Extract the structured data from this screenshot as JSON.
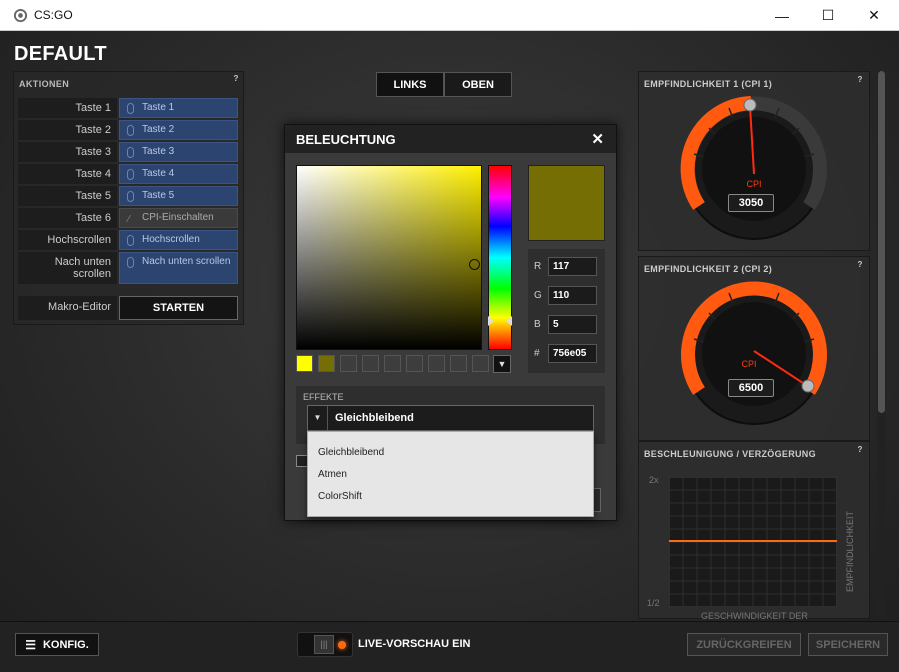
{
  "window": {
    "title": "CS:GO",
    "minimize": "—",
    "maximize": "☐",
    "close": "✕"
  },
  "profile_title": "DEFAULT",
  "actions": {
    "heading": "AKTIONEN",
    "help": "?",
    "rows": [
      {
        "label": "Taste 1",
        "value": "Taste 1"
      },
      {
        "label": "Taste 2",
        "value": "Taste 2"
      },
      {
        "label": "Taste 3",
        "value": "Taste 3"
      },
      {
        "label": "Taste 4",
        "value": "Taste 4"
      },
      {
        "label": "Taste 5",
        "value": "Taste 5"
      },
      {
        "label": "Taste 6",
        "value": "CPI-Einschalten"
      },
      {
        "label": "Hochscrollen",
        "value": "Hochscrollen"
      },
      {
        "label": "Nach unten scrollen",
        "value": "Nach unten scrollen"
      }
    ],
    "macro_label": "Makro-Editor",
    "macro_button": "STARTEN"
  },
  "toggle": {
    "left": "LINKS",
    "right": "OBEN"
  },
  "lighting": {
    "title": "BELEUCHTUNG",
    "close": "✕",
    "color": {
      "hex_color": "#756e05",
      "r": "117",
      "g": "110",
      "b": "5",
      "hex": "756e05"
    },
    "swatch_colors": [
      "#ffff00",
      "#756e05"
    ],
    "effects_label": "EFFEKTE",
    "effect_selected": "Gleichbleibend",
    "effect_options": [
      "Gleichbleibend",
      "Atmen",
      "ColorShift"
    ]
  },
  "sensitivity": {
    "cpi1": {
      "heading": "EMPFINDLICHKEIT 1 (CPI 1)",
      "unit": "CPI",
      "value": "3050",
      "level": 0.47
    },
    "cpi2": {
      "heading": "EMPFINDLICHKEIT 2 (CPI 2)",
      "unit": "CPI",
      "value": "6500",
      "level": 0.92
    },
    "accel": {
      "heading": "BESCHLEUNIGUNG / VERZÖGERUNG",
      "y_top": "2x",
      "y_bottom": "1/2",
      "y_label": "EMPFINDLICHKEIT",
      "x_label": "GESCHWINDIGKEIT DER"
    },
    "help": "?"
  },
  "bottom": {
    "config": "KONFIG.",
    "live_preview": "LIVE-VORSCHAU EIN",
    "revert": "ZURÜCKGREIFEN",
    "save": "SPEICHERN"
  },
  "colors": {
    "accent": "#ff6a10",
    "blue": "#2c4470"
  }
}
